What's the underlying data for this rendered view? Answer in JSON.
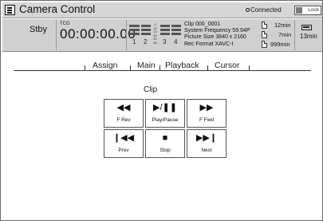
{
  "window": {
    "title": "Camera Control",
    "connection_status": "Connected",
    "lock_label": "Lock"
  },
  "status": {
    "mode": "Stby",
    "tc_label": "TCG",
    "timecode": "00:00:00.00",
    "audio_scale": [
      "0",
      "10",
      "20",
      "30",
      "40",
      "50"
    ],
    "audio_channels": [
      "1",
      "2",
      "3",
      "4"
    ],
    "clip_name": "Clip 000_0001",
    "system_frequency": "System Frequency 59.94P",
    "picture_size": "Picture Size  3840 x 2160",
    "rec_format": "Rec Format  XAVC-I",
    "media_a_time": "12min",
    "media_b_time": "7min",
    "media_c_time": "999min",
    "battery_time": "13min"
  },
  "tabs": [
    {
      "label": "Assign"
    },
    {
      "label": "Main"
    },
    {
      "label": "Playback"
    },
    {
      "label": "Cursor"
    }
  ],
  "clip_section": {
    "title": "Clip",
    "buttons": [
      {
        "symbol": "◀◀",
        "label": "F Rev",
        "icon": "rewind-icon"
      },
      {
        "symbol": "▶/❚❚",
        "label": "Play/Pause",
        "icon": "play-pause-icon"
      },
      {
        "symbol": "▶▶",
        "label": "F Fwd",
        "icon": "fast-forward-icon"
      },
      {
        "symbol": "❙◀◀",
        "label": "Prev",
        "icon": "previous-icon"
      },
      {
        "symbol": "■",
        "label": "Stop",
        "icon": "stop-icon"
      },
      {
        "symbol": "▶▶❙",
        "label": "Next",
        "icon": "next-icon"
      }
    ]
  },
  "colors": {
    "titlebar_bg": "#d6d6d6",
    "status_bg": "#d0d0d0",
    "button_border": "#555555"
  }
}
